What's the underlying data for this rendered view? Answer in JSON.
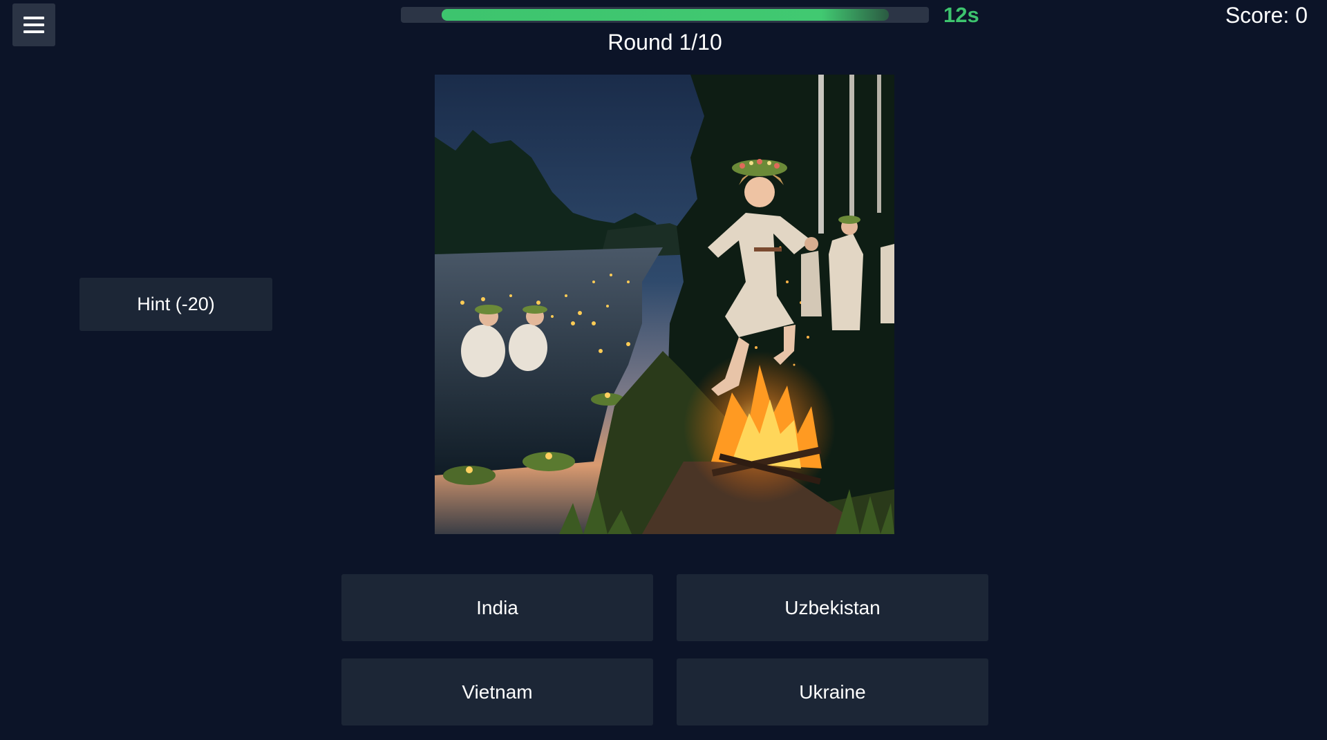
{
  "header": {
    "menu_icon": "hamburger-menu-icon",
    "timer": {
      "remaining_label": "12s",
      "remaining_fraction": 0.95,
      "color": "#3dc46e"
    },
    "score_label": "Score: 0",
    "round_label": "Round 1/10"
  },
  "hint": {
    "label": "Hint (-20)"
  },
  "question_image": {
    "subject": "midsummer-bonfire-photo"
  },
  "answers": [
    {
      "label": "India"
    },
    {
      "label": "Uzbekistan"
    },
    {
      "label": "Vietnam"
    },
    {
      "label": "Ukraine"
    }
  ],
  "colors": {
    "background": "#0c1428",
    "button": "#1c2636",
    "accent_green": "#3dc46e"
  }
}
